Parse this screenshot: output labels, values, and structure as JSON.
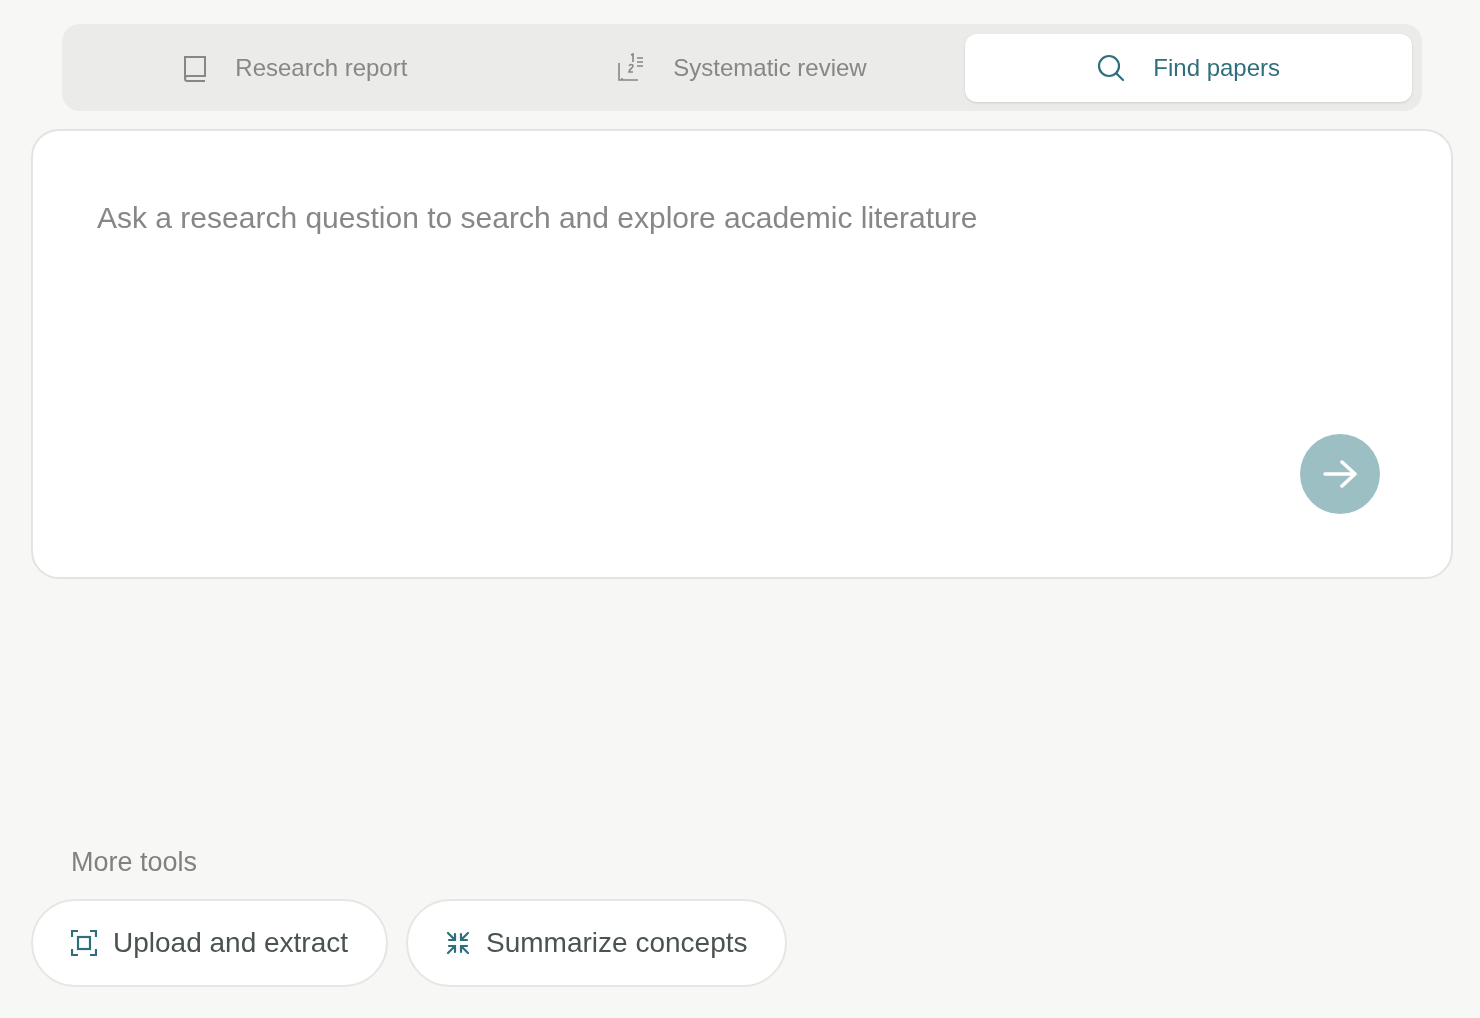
{
  "tabs": [
    {
      "kind": "report",
      "label": "Research report",
      "selected": false
    },
    {
      "kind": "review",
      "label": "Systematic review",
      "selected": false
    },
    {
      "kind": "search",
      "label": "Find papers",
      "selected": true
    }
  ],
  "query": {
    "placeholder": "Ask a research question to search and explore academic literature",
    "submit_disabled": true
  },
  "more_tools": {
    "heading": "More tools",
    "items": [
      {
        "kind": "extract",
        "label": "Upload and extract"
      },
      {
        "kind": "summarize",
        "label": "Summarize concepts"
      }
    ]
  }
}
